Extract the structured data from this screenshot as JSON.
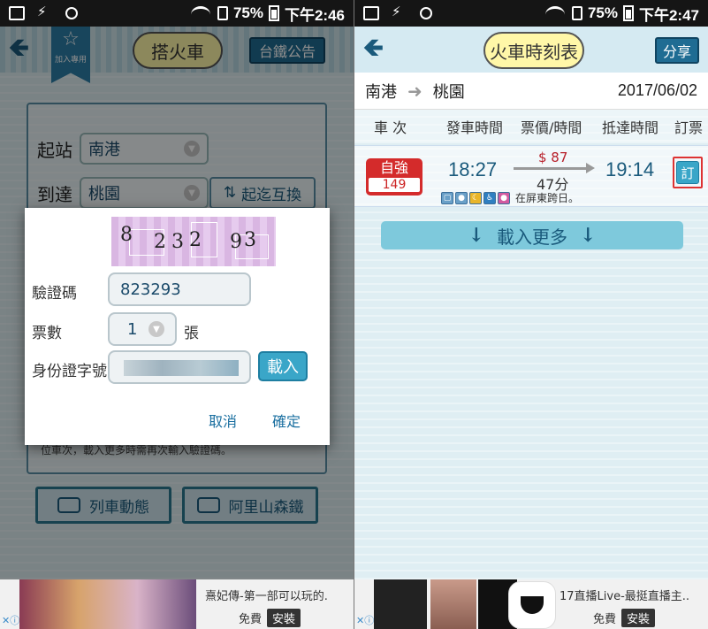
{
  "status_bar_left": {
    "battery": "75%",
    "time": "下午2:46"
  },
  "status_bar_right": {
    "battery": "75%",
    "time": "下午2:47"
  },
  "left": {
    "title": "搭火車",
    "bookmark_label": "加入專用",
    "notice_button": "台鐵公告",
    "from_label": "起站",
    "from_value": "南港",
    "to_label": "到達",
    "to_value": "桃園",
    "swap_button": "起迄互換",
    "note": "位車次，載入更多時需再次輸入驗證碼。",
    "btn_train_status": "列車動態",
    "btn_alishan": "阿里山森鐵",
    "dialog": {
      "captcha_chars": [
        "8",
        "2",
        "3",
        "2",
        "9",
        "3"
      ],
      "captcha_label": "驗證碼",
      "captcha_value": "823293",
      "tickets_label": "票數",
      "tickets_value": "1",
      "tickets_unit": "張",
      "id_label": "身份證字號",
      "load_button": "載入",
      "cancel": "取消",
      "confirm": "確定"
    },
    "ad": {
      "title": "熹妃傳-第一部可以玩的.",
      "free": "免費",
      "install": "安裝"
    }
  },
  "right": {
    "title": "火車時刻表",
    "share_button": "分享",
    "from": "南港",
    "to": "桃園",
    "date": "2017/06/02",
    "columns": [
      "車 次",
      "發車時間",
      "票價/時間",
      "抵達時間",
      "訂票"
    ],
    "row": {
      "type": "自強",
      "number": "149",
      "depart": "18:27",
      "price": "$ 87",
      "duration": "47分",
      "arrive": "19:14",
      "amenity_note": "在屏東跨日。",
      "book_label": "訂"
    },
    "load_more": "載入更多",
    "ad": {
      "title": "17直播Live-最挺直播主..",
      "free": "免費",
      "install": "安裝"
    }
  },
  "colors": {
    "primary": "#1f6c93",
    "accent_red": "#d42b2b",
    "paper": "#dfeef3"
  }
}
